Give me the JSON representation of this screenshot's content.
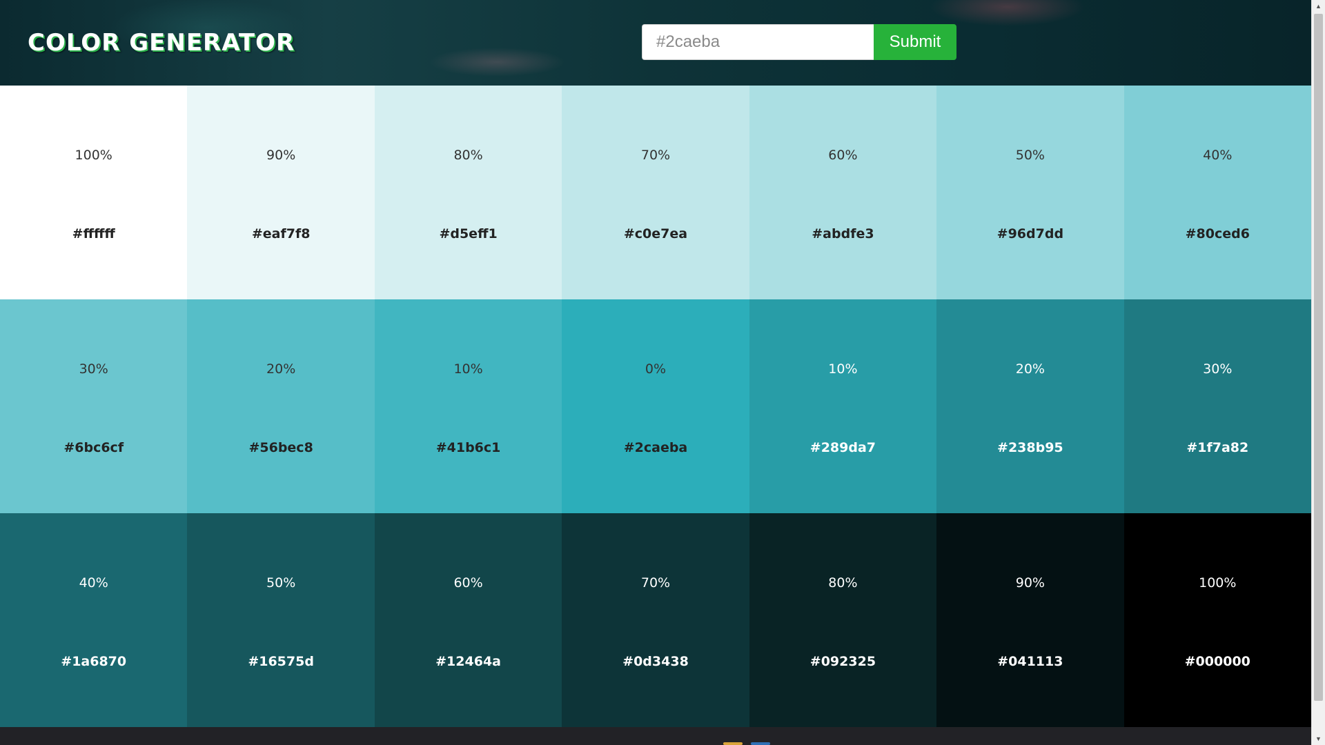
{
  "header": {
    "title": "COLOR GENERATOR",
    "input_value": "",
    "input_placeholder": "#2caeba",
    "submit_label": "Submit"
  },
  "swatches": [
    {
      "percent": "100%",
      "hex": "#ffffff",
      "tone": "light"
    },
    {
      "percent": "90%",
      "hex": "#eaf7f8",
      "tone": "light"
    },
    {
      "percent": "80%",
      "hex": "#d5eff1",
      "tone": "light"
    },
    {
      "percent": "70%",
      "hex": "#c0e7ea",
      "tone": "light"
    },
    {
      "percent": "60%",
      "hex": "#abdfe3",
      "tone": "light"
    },
    {
      "percent": "50%",
      "hex": "#96d7dd",
      "tone": "light"
    },
    {
      "percent": "40%",
      "hex": "#80ced6",
      "tone": "light"
    },
    {
      "percent": "30%",
      "hex": "#6bc6cf",
      "tone": "light"
    },
    {
      "percent": "20%",
      "hex": "#56bec8",
      "tone": "light"
    },
    {
      "percent": "10%",
      "hex": "#41b6c1",
      "tone": "light"
    },
    {
      "percent": "0%",
      "hex": "#2caeba",
      "tone": "light"
    },
    {
      "percent": "10%",
      "hex": "#289da7",
      "tone": "dark"
    },
    {
      "percent": "20%",
      "hex": "#238b95",
      "tone": "dark"
    },
    {
      "percent": "30%",
      "hex": "#1f7a82",
      "tone": "dark"
    },
    {
      "percent": "40%",
      "hex": "#1a6870",
      "tone": "dark"
    },
    {
      "percent": "50%",
      "hex": "#16575d",
      "tone": "dark"
    },
    {
      "percent": "60%",
      "hex": "#12464a",
      "tone": "dark"
    },
    {
      "percent": "70%",
      "hex": "#0d3438",
      "tone": "dark"
    },
    {
      "percent": "80%",
      "hex": "#092325",
      "tone": "dark"
    },
    {
      "percent": "90%",
      "hex": "#041113",
      "tone": "dark"
    },
    {
      "percent": "100%",
      "hex": "#000000",
      "tone": "dark"
    }
  ],
  "colors": {
    "submit_bg": "#27b23a",
    "footer_bg": "#222226",
    "footer_mark_left": "#d9a43a",
    "footer_mark_right": "#2f6fb5"
  }
}
